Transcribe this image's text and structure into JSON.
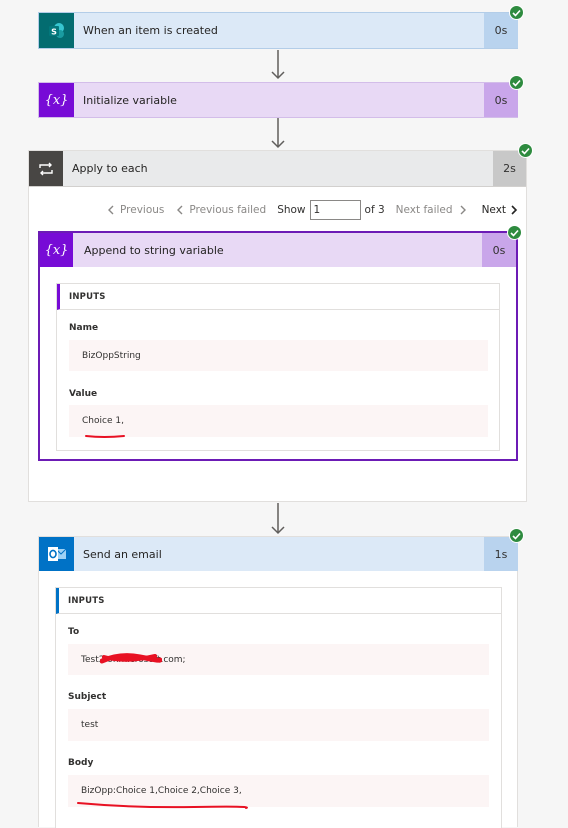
{
  "steps": {
    "trigger": {
      "title": "When an item is created",
      "duration": "0s",
      "icon": "sharepoint-icon"
    },
    "init_var": {
      "title": "Initialize variable",
      "duration": "0s",
      "icon": "variable-icon"
    },
    "apply_each": {
      "title": "Apply to each",
      "duration": "2s",
      "icon": "loop-icon",
      "pager": {
        "previous": "Previous",
        "previous_failed": "Previous failed",
        "show": "Show",
        "current": "1",
        "of": "of 3",
        "next_failed": "Next failed",
        "next": "Next"
      },
      "inner": {
        "title": "Append to string variable",
        "duration": "0s",
        "icon": "variable-icon",
        "inputs_header": "INPUTS",
        "fields": [
          {
            "label": "Name",
            "value": "BizOppString"
          },
          {
            "label": "Value",
            "value": "Choice 1,"
          }
        ]
      }
    },
    "send_email": {
      "title": "Send an email",
      "duration": "1s",
      "icon": "outlook-icon",
      "inputs_header": "INPUTS",
      "fields": [
        {
          "label": "To",
          "value": "Test2              onmicrosoft.com;"
        },
        {
          "label": "Subject",
          "value": "test"
        },
        {
          "label": "Body",
          "value": "BizOpp:Choice 1,Choice 2,Choice 3,"
        }
      ]
    }
  },
  "colors": {
    "sharepoint": "#036c70",
    "variable": "#770bd6",
    "loop_header": "#484644",
    "outlook": "#0072c6",
    "success": "#2e8b3f",
    "annotation_red": "#e81123"
  }
}
